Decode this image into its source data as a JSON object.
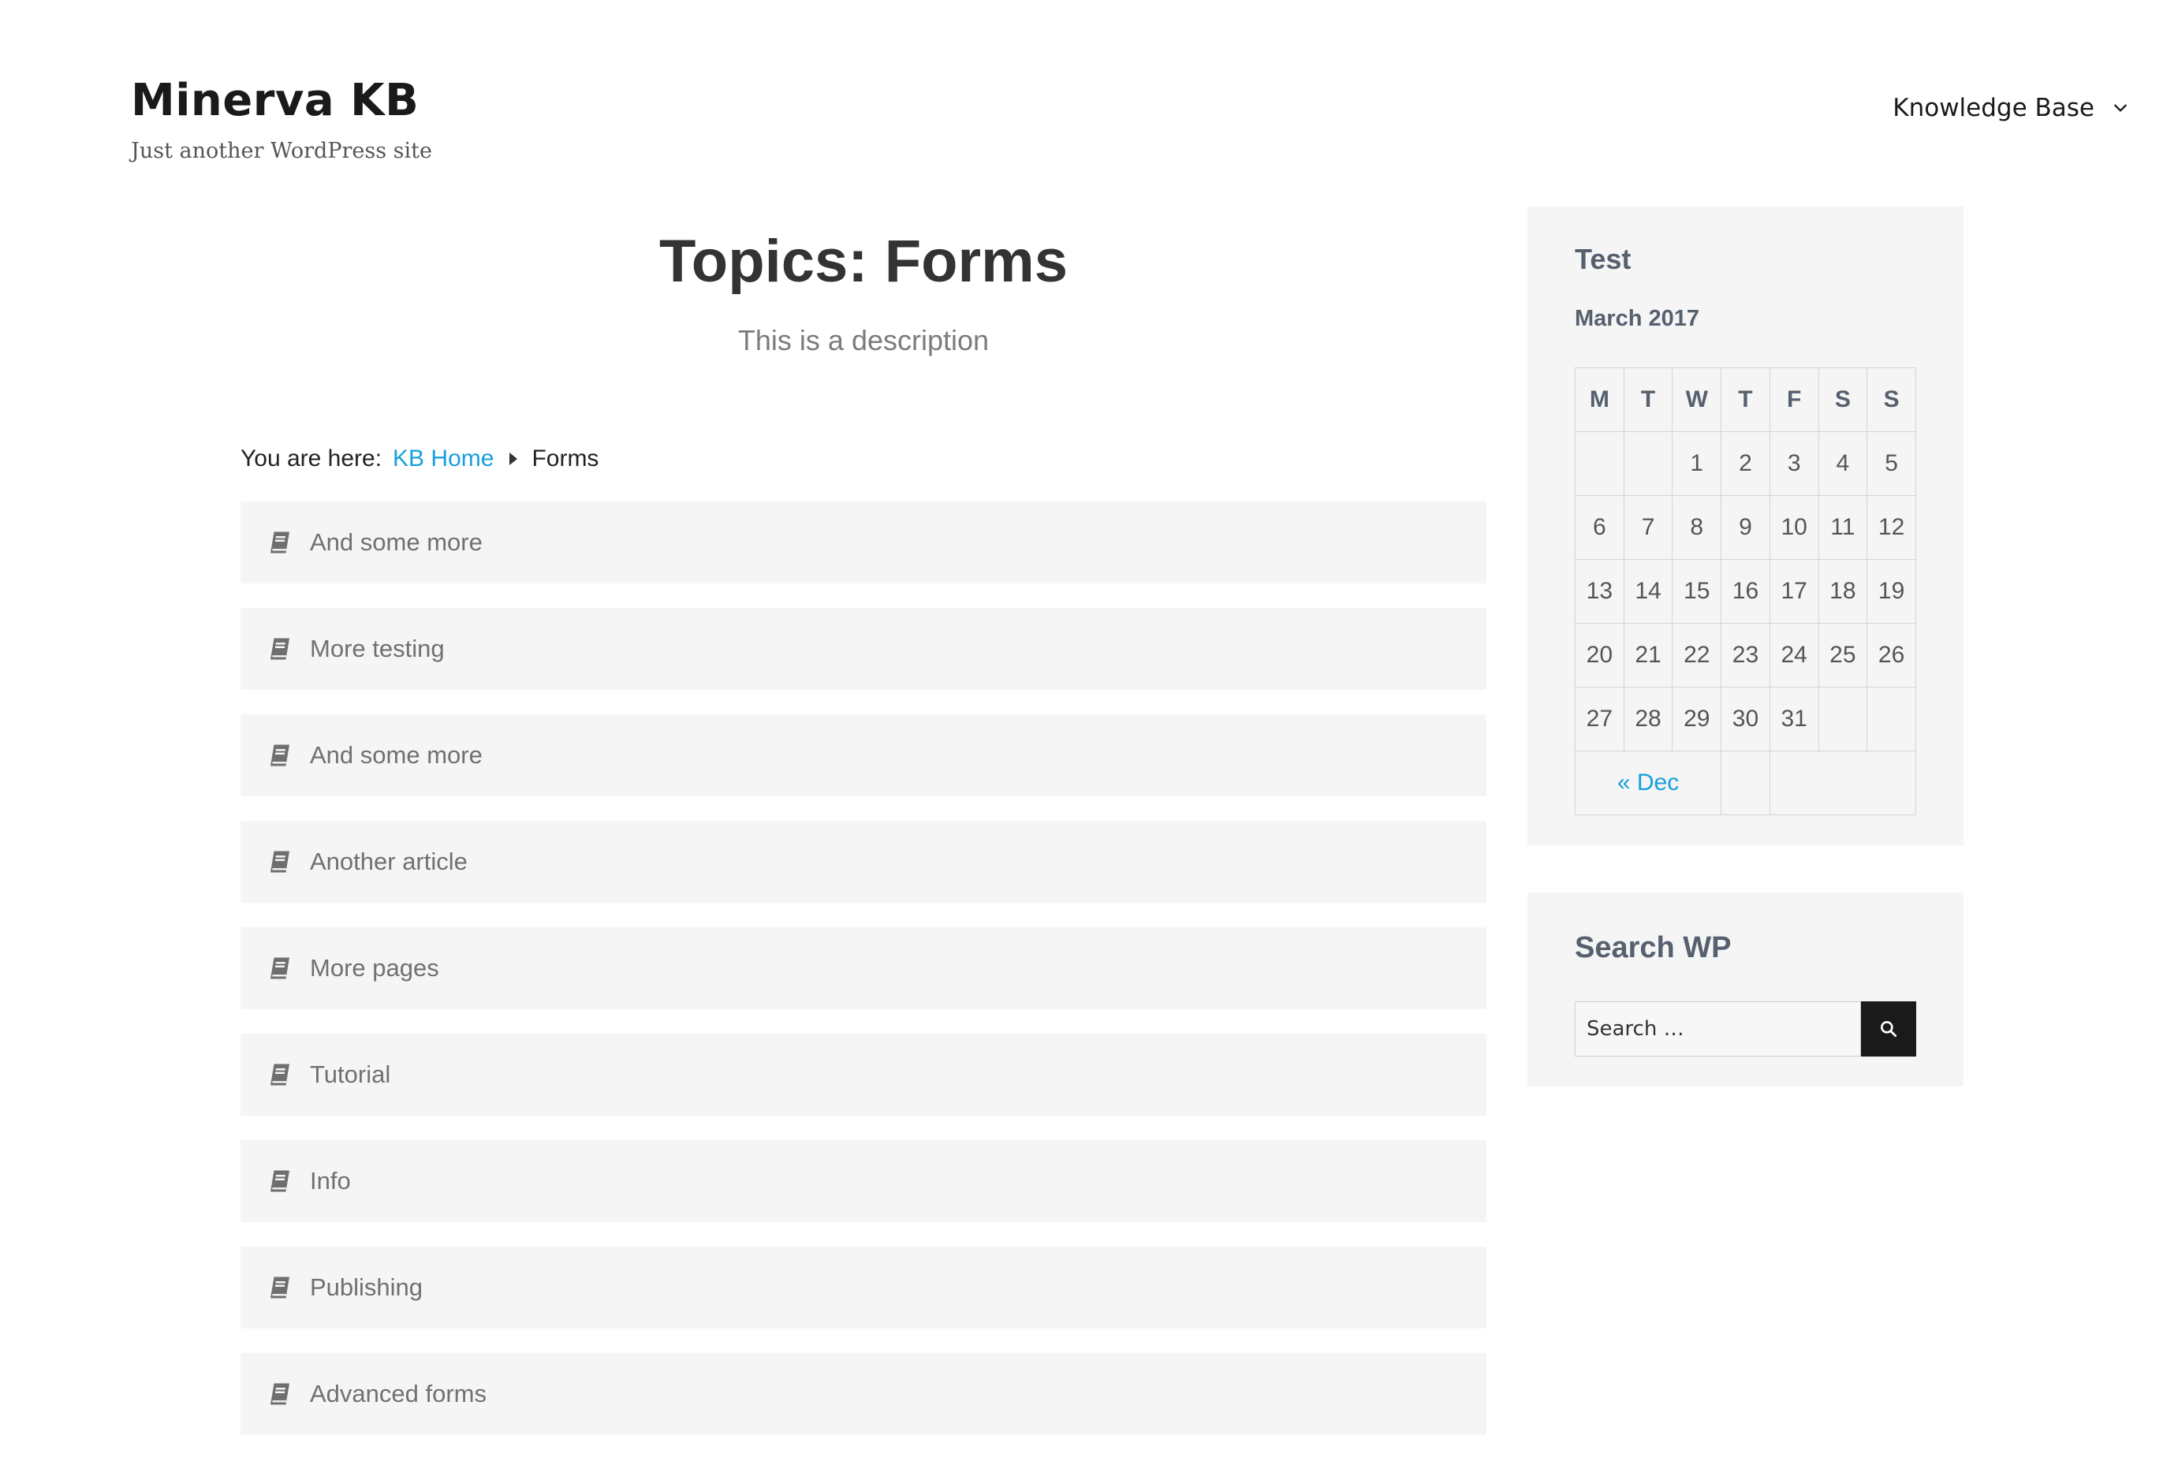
{
  "site": {
    "title": "Minerva KB",
    "tagline": "Just another WordPress site"
  },
  "nav": {
    "menu_label": "Knowledge Base"
  },
  "page": {
    "title": "Topics: Forms",
    "description": "This is a description"
  },
  "breadcrumb": {
    "prefix": "You are here:",
    "home": "KB Home",
    "current": "Forms"
  },
  "articles": [
    {
      "label": "And some more"
    },
    {
      "label": "More testing"
    },
    {
      "label": "And some more"
    },
    {
      "label": "Another article"
    },
    {
      "label": "More pages"
    },
    {
      "label": "Tutorial"
    },
    {
      "label": "Info"
    },
    {
      "label": "Publishing"
    },
    {
      "label": "Advanced forms"
    }
  ],
  "sidebar": {
    "calendar_widget": {
      "title": "Test",
      "caption": "March 2017",
      "weekdays": [
        "M",
        "T",
        "W",
        "T",
        "F",
        "S",
        "S"
      ],
      "weeks": [
        [
          "",
          "",
          "1",
          "2",
          "3",
          "4",
          "5"
        ],
        [
          "6",
          "7",
          "8",
          "9",
          "10",
          "11",
          "12"
        ],
        [
          "13",
          "14",
          "15",
          "16",
          "17",
          "18",
          "19"
        ],
        [
          "20",
          "21",
          "22",
          "23",
          "24",
          "25",
          "26"
        ],
        [
          "27",
          "28",
          "29",
          "30",
          "31",
          "",
          ""
        ]
      ],
      "prev_link": "« Dec"
    },
    "search_widget": {
      "title": "Search WP",
      "placeholder": "Search …"
    }
  },
  "icons": {
    "article": "book-icon",
    "search": "search-icon",
    "menu": "chevron-down-icon"
  },
  "colors": {
    "link": "#16a0dc",
    "widget_bg": "#f5f5f5",
    "article_bg": "#f5f5f5",
    "search_button": "#1a1a1a"
  }
}
